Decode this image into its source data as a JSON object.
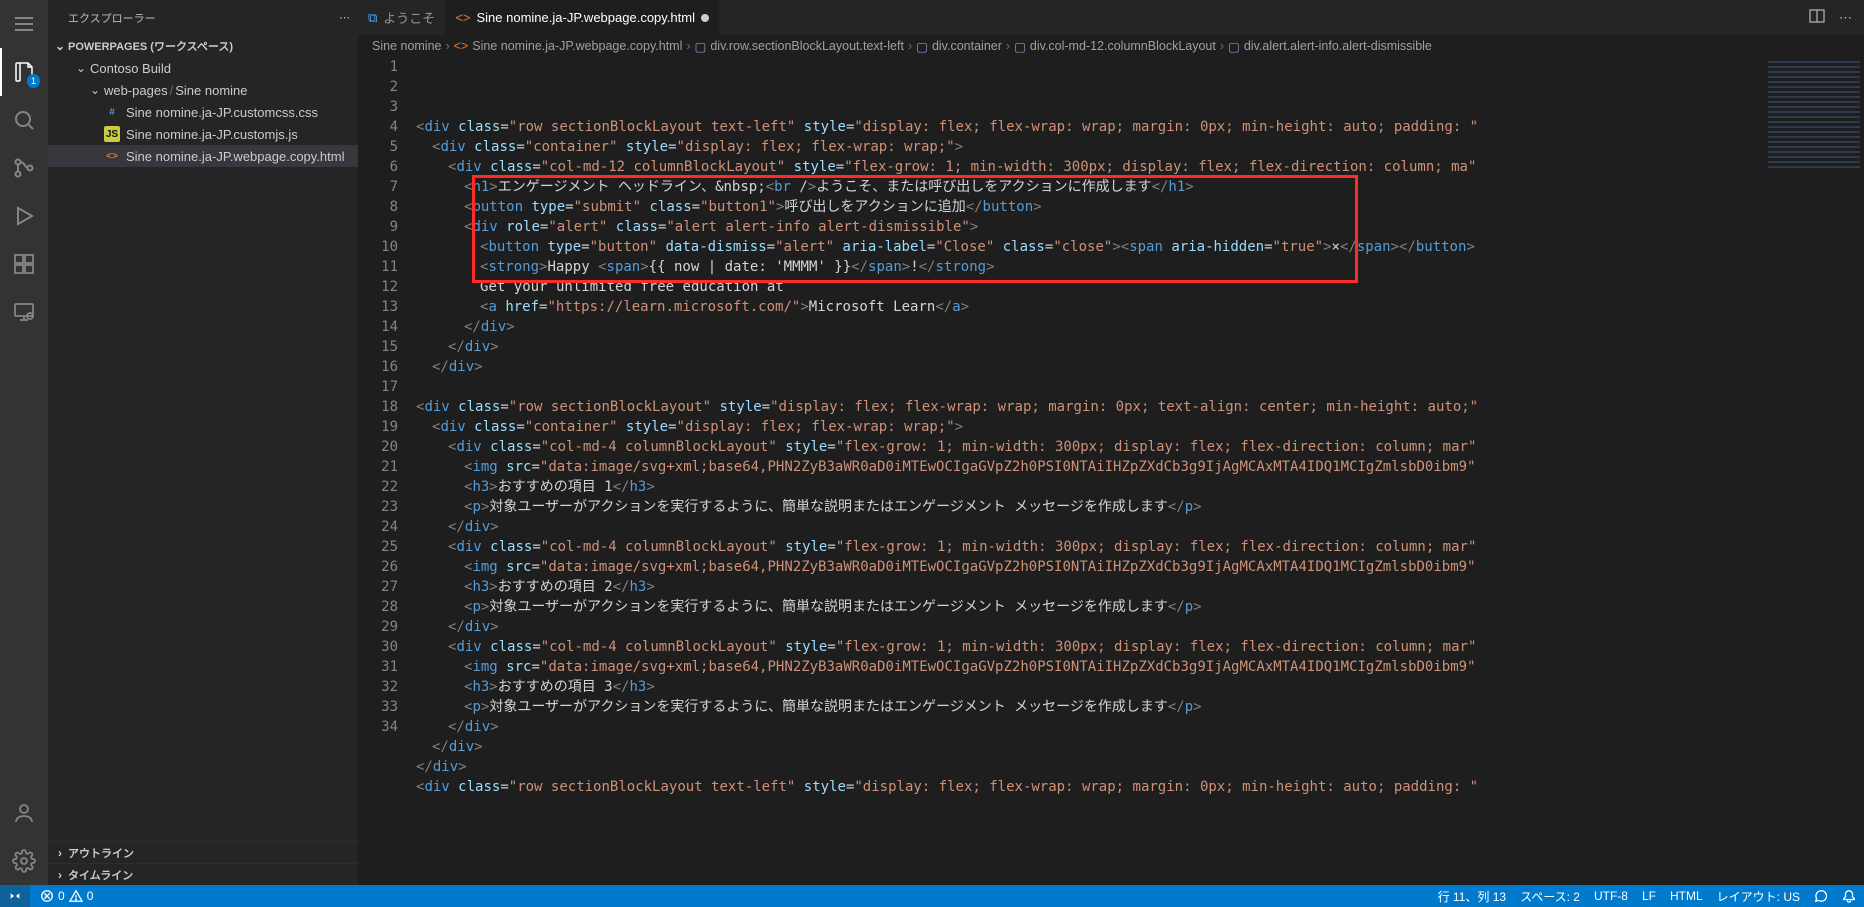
{
  "sidebar": {
    "title": "エクスプローラー",
    "workspace": "POWERPAGES (ワークスペース)",
    "folders": {
      "root": "Contoso Build",
      "webpages": "web-pages",
      "sinenomine": "Sine nomine"
    },
    "files": [
      "Sine nomine.ja-JP.customcss.css",
      "Sine nomine.ja-JP.customjs.js",
      "Sine nomine.ja-JP.webpage.copy.html"
    ],
    "outline": "アウトライン",
    "timeline": "タイムライン"
  },
  "tabs": {
    "welcome": "ようこそ",
    "file": "Sine nomine.ja-JP.webpage.copy.html"
  },
  "breadcrumbs": [
    "Sine nomine",
    "Sine nomine.ja-JP.webpage.copy.html",
    "div.row.sectionBlockLayout.text-left",
    "div.container",
    "div.col-md-12.columnBlockLayout",
    "div.alert.alert-info.alert-dismissible"
  ],
  "code": {
    "l1": "<div class=\"row sectionBlockLayout text-left\" style=\"display: flex; flex-wrap: wrap; margin: 0px; min-height: auto; padding: ",
    "l2": "  <div class=\"container\" style=\"display: flex; flex-wrap: wrap;\">",
    "l3": "    <div class=\"col-md-12 columnBlockLayout\" style=\"flex-grow: 1; min-width: 300px; display: flex; flex-direction: column; ma",
    "l4": "      <h1>エンゲージメント ヘッドライン、&nbsp;<br />ようこそ、または呼び出しをアクションに作成します</h1>",
    "l5": "      <button type=\"submit\" class=\"button1\">呼び出しをアクションに追加</button>",
    "l6": "      <div role=\"alert\" class=\"alert alert-info alert-dismissible\">",
    "l7": "        <button type=\"button\" data-dismiss=\"alert\" aria-label=\"Close\" class=\"close\"><span aria-hidden=\"true\">×</span></button>",
    "l8": "        <strong>Happy <span>{{ now | date: 'MMMM' }}</span>!</strong>",
    "l9": "        Get your unlimited free education at",
    "l10": "        <a href=\"https://learn.microsoft.com/\">Microsoft Learn</a>",
    "l11": "      </div>",
    "l12": "    </div>",
    "l13": "  </div>",
    "l14": "",
    "l15": "<div class=\"row sectionBlockLayout\" style=\"display: flex; flex-wrap: wrap; margin: 0px; text-align: center; min-height: auto;",
    "l16": "  <div class=\"container\" style=\"display: flex; flex-wrap: wrap;\">",
    "l17": "    <div class=\"col-md-4 columnBlockLayout\" style=\"flex-grow: 1; min-width: 300px; display: flex; flex-direction: column; mar",
    "l18": "      <img src=\"data:image/svg+xml;base64,PHN2ZyB3aWR0aD0iMTEwOCIgaGVpZ2h0PSI0NTAiIHZpZXdCb3g9IjAgMCAxMTA4IDQ1MCIgZmlsbD0ibm9",
    "l19": "      <h3>おすすめの項目 1</h3>",
    "l20": "      <p>対象ユーザーがアクションを実行するように、簡単な説明またはエンゲージメント メッセージを作成します</p>",
    "l21": "    </div>",
    "l22": "    <div class=\"col-md-4 columnBlockLayout\" style=\"flex-grow: 1; min-width: 300px; display: flex; flex-direction: column; mar",
    "l23": "      <img src=\"data:image/svg+xml;base64,PHN2ZyB3aWR0aD0iMTEwOCIgaGVpZ2h0PSI0NTAiIHZpZXdCb3g9IjAgMCAxMTA4IDQ1MCIgZmlsbD0ibm9",
    "l24": "      <h3>おすすめの項目 2</h3>",
    "l25": "      <p>対象ユーザーがアクションを実行するように、簡単な説明またはエンゲージメント メッセージを作成します</p>",
    "l26": "    </div>",
    "l27": "    <div class=\"col-md-4 columnBlockLayout\" style=\"flex-grow: 1; min-width: 300px; display: flex; flex-direction: column; mar",
    "l28": "      <img src=\"data:image/svg+xml;base64,PHN2ZyB3aWR0aD0iMTEwOCIgaGVpZ2h0PSI0NTAiIHZpZXdCb3g9IjAgMCAxMTA4IDQ1MCIgZmlsbD0ibm9",
    "l29": "      <h3>おすすめの項目 3</h3>",
    "l30": "      <p>対象ユーザーがアクションを実行するように、簡単な説明またはエンゲージメント メッセージを作成します</p>",
    "l31": "    </div>",
    "l32": "  </div>",
    "l33": "</div>",
    "l34": "<div class=\"row sectionBlockLayout text-left\" style=\"display: flex; flex-wrap: wrap; margin: 0px; min-height: auto; padding: "
  },
  "status": {
    "errors": "0",
    "warnings": "0",
    "cursor": "行 11、列 13",
    "spaces": "スペース: 2",
    "encoding": "UTF-8",
    "eol": "LF",
    "lang": "HTML",
    "layout": "レイアウト: US",
    "bell": ""
  }
}
